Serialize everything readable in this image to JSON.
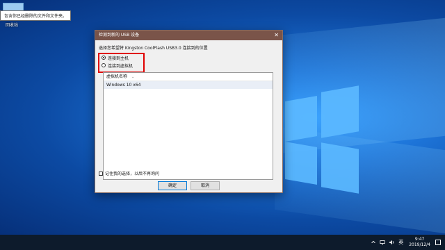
{
  "desktop": {
    "tooltip": "包含你已经删除的文件和文件夹。",
    "icon_label": "回收站"
  },
  "dialog": {
    "title": "检测到新的 USB 设备",
    "instruction": "选择您希望将 Kingston CoolFlash USB3.0 连接到的位置",
    "radio_host": "连接到主机",
    "radio_vm": "连接到虚拟机",
    "selected": "连接到主机",
    "vm_column_header": "虚拟机名称",
    "vm_rows": [
      "Windows 10 x64"
    ],
    "remember_label": "记住我的选择，以后不再询问",
    "ok_label": "确定",
    "cancel_label": "取消"
  },
  "taskbar": {
    "ime_label": "英",
    "time": "9:47",
    "date": "2019/12/4"
  },
  "colors": {
    "titlebar": "#7a5449",
    "highlight_box": "#e00000",
    "taskbar": "#0d1b2c"
  }
}
